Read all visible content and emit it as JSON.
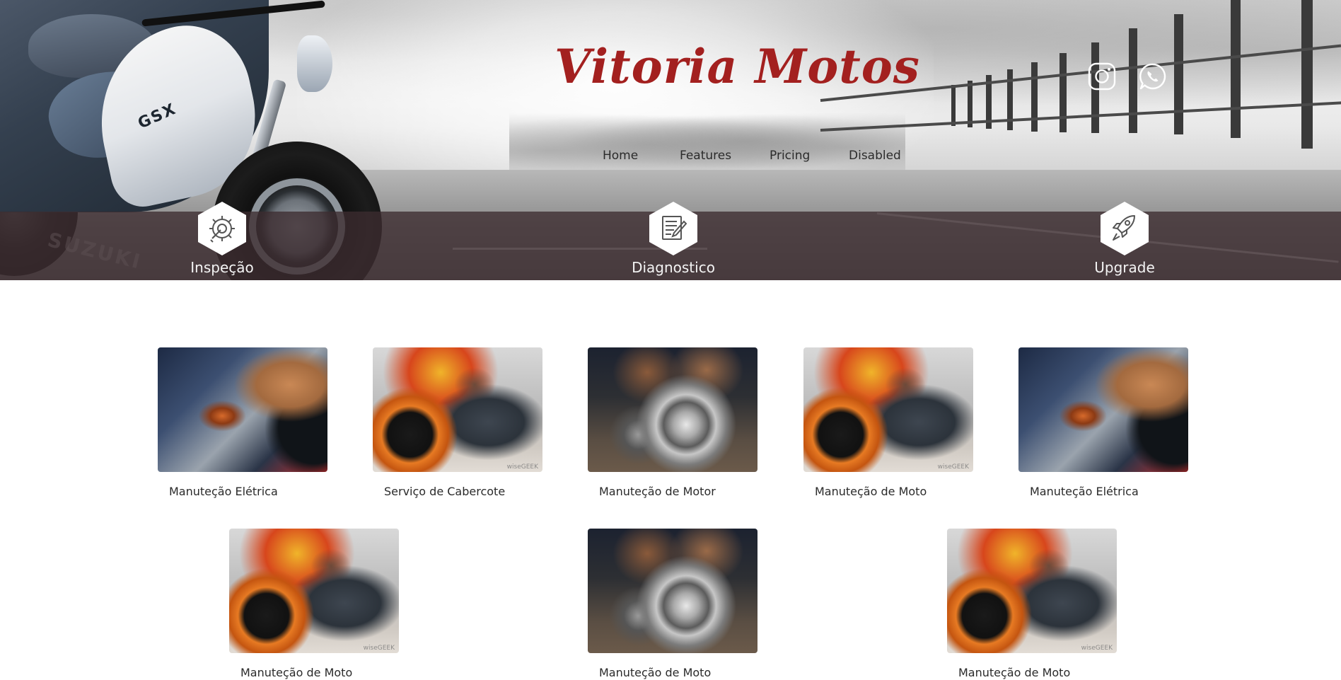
{
  "brand": {
    "title": "Vitoria Motos"
  },
  "social": [
    {
      "name": "instagram",
      "icon": "instagram-icon"
    },
    {
      "name": "whatsapp",
      "icon": "whatsapp-icon"
    }
  ],
  "nav": {
    "items": [
      {
        "label": "Home"
      },
      {
        "label": "Features"
      },
      {
        "label": "Pricing"
      },
      {
        "label": "Disabled"
      }
    ]
  },
  "features": [
    {
      "label": "Inspeção",
      "icon": "gear-wrench-icon"
    },
    {
      "label": "Diagnostico",
      "icon": "document-pencil-icon"
    },
    {
      "label": "Upgrade",
      "icon": "rocket-icon"
    }
  ],
  "gallery": {
    "row1": [
      {
        "caption": "Manuteção Elétrica"
      },
      {
        "caption": "Serviço de Cabercote"
      },
      {
        "caption": "Manuteção de Motor"
      },
      {
        "caption": "Manuteção de Moto"
      },
      {
        "caption": "Manuteção Elétrica"
      }
    ],
    "row2": [
      {
        "caption": "Manuteção de Moto"
      },
      {
        "caption": "Manuteção de Moto"
      },
      {
        "caption": "Manuteção de Moto"
      }
    ],
    "watermark": "wiseGEEK"
  },
  "colors": {
    "brand": "#a3201f",
    "band": "#3c2c30",
    "nav_text": "#2b2b2b",
    "caption_text": "#2a2a2a"
  }
}
